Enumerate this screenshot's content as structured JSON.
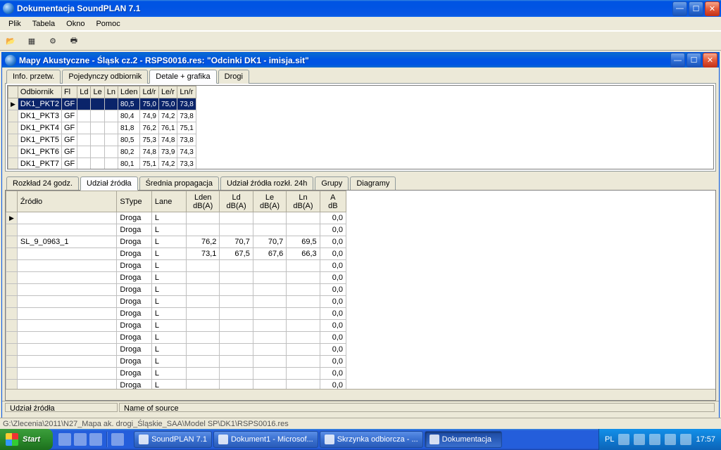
{
  "app": {
    "title": "Dokumentacja SoundPLAN 7.1"
  },
  "menubar": [
    "Plik",
    "Tabela",
    "Okno",
    "Pomoc"
  ],
  "toolbar_icons": [
    "open-icon",
    "table-icon",
    "run-icon",
    "print-icon"
  ],
  "child_window": {
    "title": "Mapy Akustyczne - Śląsk cz.2 - RSPS0016.res: \"Odcinki DK1 - imisja.sit\""
  },
  "tabs1": {
    "items": [
      "Info. przetw.",
      "Pojedynczy odbiornik",
      "Detale + grafika",
      "Drogi"
    ],
    "active": 2
  },
  "grid1": {
    "headers": [
      "Odbiornik",
      "Fl",
      "Ld",
      "Le",
      "Ln",
      "Lden",
      "Ld/r",
      "Le/r",
      "Ln/r"
    ],
    "rows": [
      {
        "id": "DK1_PKT2",
        "fl": "GF",
        "vals": [
          "80,5",
          "75,0",
          "75,0",
          "73,8"
        ],
        "selected": true
      },
      {
        "id": "DK1_PKT3",
        "fl": "GF",
        "vals": [
          "80,4",
          "74,9",
          "74,2",
          "73,8"
        ]
      },
      {
        "id": "DK1_PKT4",
        "fl": "GF",
        "vals": [
          "81,8",
          "76,2",
          "76,1",
          "75,1"
        ]
      },
      {
        "id": "DK1_PKT5",
        "fl": "GF",
        "vals": [
          "80,5",
          "75,3",
          "74,8",
          "73,8"
        ]
      },
      {
        "id": "DK1_PKT6",
        "fl": "GF",
        "vals": [
          "80,2",
          "74,8",
          "73,9",
          "74,3"
        ]
      },
      {
        "id": "DK1_PKT7",
        "fl": "GF",
        "vals": [
          "80,1",
          "75,1",
          "74,2",
          "73,3"
        ]
      }
    ]
  },
  "tabs2": {
    "items": [
      "Rozkład 24 godz.",
      "Udział źródła",
      "Średnia propagacja",
      "Udział źródła rozkł. 24h",
      "Grupy",
      "Diagramy"
    ],
    "active": 1
  },
  "grid2": {
    "headers": [
      "Źródło",
      "SType",
      "Lane",
      "Lden\ndB(A)",
      "Ld\ndB(A)",
      "Le\ndB(A)",
      "Ln\ndB(A)",
      "A\ndB"
    ],
    "rows": [
      {
        "z": "",
        "stype": "Droga",
        "lane": "L",
        "lden": "",
        "ld": "",
        "le": "",
        "ln": "",
        "a": "0,0",
        "selected": true
      },
      {
        "z": "",
        "stype": "Droga",
        "lane": "L",
        "lden": "",
        "ld": "",
        "le": "",
        "ln": "",
        "a": "0,0"
      },
      {
        "z": "SL_9_0963_1",
        "stype": "Droga",
        "lane": "L",
        "lden": "76,2",
        "ld": "70,7",
        "le": "70,7",
        "ln": "69,5",
        "a": "0,0"
      },
      {
        "z": "",
        "stype": "Droga",
        "lane": "L",
        "lden": "73,1",
        "ld": "67,5",
        "le": "67,6",
        "ln": "66,3",
        "a": "0,0"
      },
      {
        "z": "",
        "stype": "Droga",
        "lane": "L",
        "lden": "",
        "ld": "",
        "le": "",
        "ln": "",
        "a": "0,0"
      },
      {
        "z": "",
        "stype": "Droga",
        "lane": "L",
        "lden": "",
        "ld": "",
        "le": "",
        "ln": "",
        "a": "0,0"
      },
      {
        "z": "",
        "stype": "Droga",
        "lane": "L",
        "lden": "",
        "ld": "",
        "le": "",
        "ln": "",
        "a": "0,0"
      },
      {
        "z": "",
        "stype": "Droga",
        "lane": "L",
        "lden": "",
        "ld": "",
        "le": "",
        "ln": "",
        "a": "0,0"
      },
      {
        "z": "",
        "stype": "Droga",
        "lane": "L",
        "lden": "",
        "ld": "",
        "le": "",
        "ln": "",
        "a": "0,0"
      },
      {
        "z": "",
        "stype": "Droga",
        "lane": "L",
        "lden": "",
        "ld": "",
        "le": "",
        "ln": "",
        "a": "0,0"
      },
      {
        "z": "",
        "stype": "Droga",
        "lane": "L",
        "lden": "",
        "ld": "",
        "le": "",
        "ln": "",
        "a": "0,0"
      },
      {
        "z": "",
        "stype": "Droga",
        "lane": "L",
        "lden": "",
        "ld": "",
        "le": "",
        "ln": "",
        "a": "0,0"
      },
      {
        "z": "",
        "stype": "Droga",
        "lane": "L",
        "lden": "",
        "ld": "",
        "le": "",
        "ln": "",
        "a": "0,0"
      },
      {
        "z": "",
        "stype": "Droga",
        "lane": "L",
        "lden": "",
        "ld": "",
        "le": "",
        "ln": "",
        "a": "0,0"
      },
      {
        "z": "",
        "stype": "Droga",
        "lane": "L",
        "lden": "",
        "ld": "",
        "le": "",
        "ln": "",
        "a": "0,0"
      }
    ]
  },
  "statusbar": {
    "left": "Udział źródła",
    "right": "Name of  source"
  },
  "pathbar": "G:\\Zlecenia\\2011\\N27_Mapa ak. drogi_Śląskie_SAA\\Model SP\\DK1\\RSPS0016.res",
  "taskbar": {
    "start": "Start",
    "tasks": [
      {
        "label": "SoundPLAN 7.1",
        "active": false
      },
      {
        "label": "Dokument1 - Microsof...",
        "active": false
      },
      {
        "label": "Skrzynka odbiorcza - ...",
        "active": false
      },
      {
        "label": "Dokumentacja",
        "active": true
      }
    ],
    "tray": {
      "lang": "PL",
      "time": "17:57"
    }
  }
}
